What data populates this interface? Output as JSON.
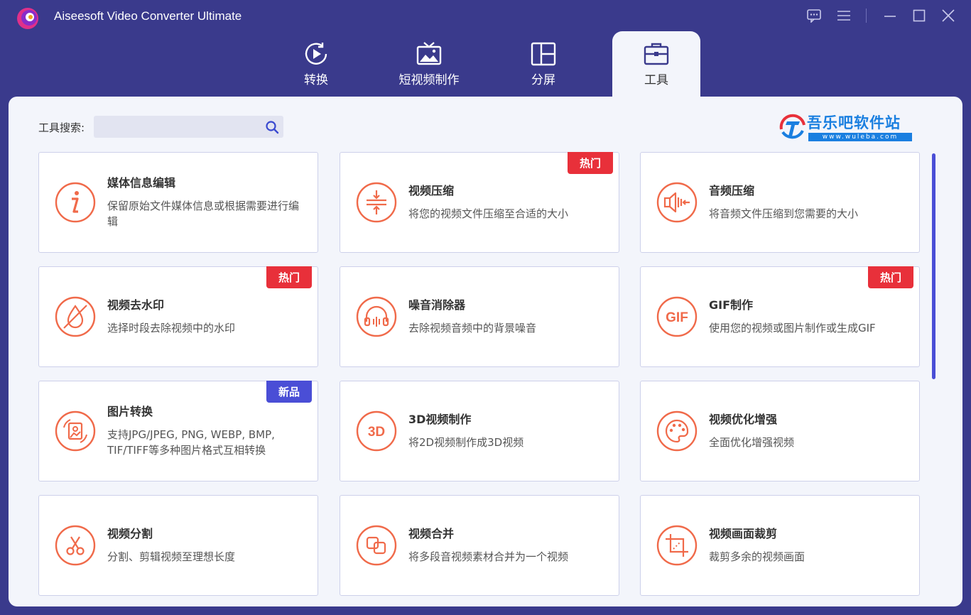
{
  "window": {
    "title": "Aiseesoft Video Converter Ultimate"
  },
  "nav": {
    "tabs": [
      {
        "label": "转换",
        "icon": "convert-icon"
      },
      {
        "label": "短视频制作",
        "icon": "mv-icon"
      },
      {
        "label": "分屏",
        "icon": "collage-icon"
      },
      {
        "label": "工具",
        "icon": "toolbox-icon",
        "active": true
      }
    ]
  },
  "search": {
    "label": "工具搜索:",
    "value": "",
    "placeholder": ""
  },
  "watermark": {
    "name": "吾乐吧软件站",
    "url": "www.wuleba.com"
  },
  "colors": {
    "accent": "#f06a4a",
    "hot": "#e8303a",
    "new": "#4a4ed6",
    "frame": "#3a3a8c"
  },
  "tools": [
    {
      "title": "媒体信息编辑",
      "desc": "保留原始文件媒体信息或根据需要进行编辑",
      "icon": "info-icon",
      "badge": ""
    },
    {
      "title": "视频压缩",
      "desc": "将您的视频文件压缩至合适的大小",
      "icon": "compress-icon",
      "badge": "热门"
    },
    {
      "title": "音频压缩",
      "desc": "将音频文件压缩到您需要的大小",
      "icon": "audio-compress-icon",
      "badge": ""
    },
    {
      "title": "视频去水印",
      "desc": "选择时段去除视频中的水印",
      "icon": "watermark-remove-icon",
      "badge": "热门"
    },
    {
      "title": "噪音消除器",
      "desc": "去除视频音频中的背景噪音",
      "icon": "headphones-icon",
      "badge": ""
    },
    {
      "title": "GIF制作",
      "desc": "使用您的视频或图片制作或生成GIF",
      "icon": "gif-icon",
      "badge": "热门"
    },
    {
      "title": "图片转换",
      "desc": "支持JPG/JPEG, PNG, WEBP, BMP, TIF/TIFF等多种图片格式互相转换",
      "icon": "image-convert-icon",
      "badge": "新品"
    },
    {
      "title": "3D视频制作",
      "desc": "将2D视频制作成3D视频",
      "icon": "3d-icon",
      "badge": ""
    },
    {
      "title": "视频优化增强",
      "desc": "全面优化增强视频",
      "icon": "palette-icon",
      "badge": ""
    },
    {
      "title": "视频分割",
      "desc": "分割、剪辑视频至理想长度",
      "icon": "scissors-icon",
      "badge": ""
    },
    {
      "title": "视频合并",
      "desc": "将多段音视频素材合并为一个视频",
      "icon": "merge-icon",
      "badge": ""
    },
    {
      "title": "视频画面裁剪",
      "desc": "裁剪多余的视频画面",
      "icon": "crop-icon",
      "badge": ""
    }
  ]
}
